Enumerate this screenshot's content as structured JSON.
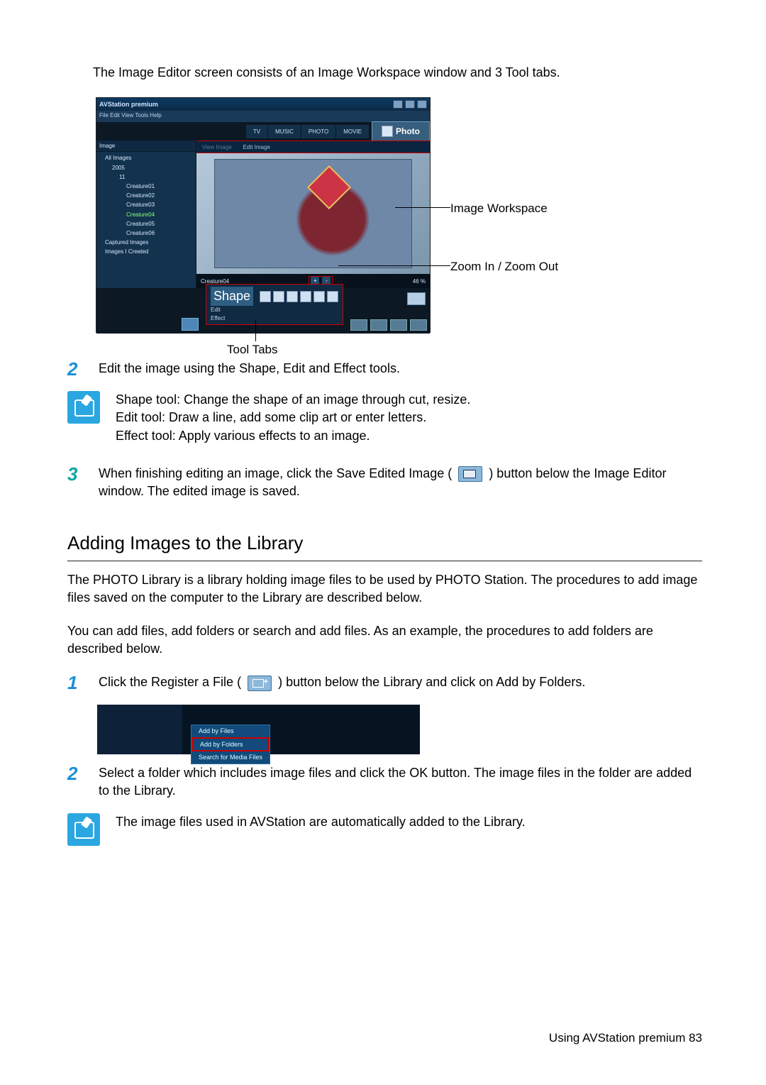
{
  "intro": "The Image Editor screen consists of an Image Workspace window and 3 Tool tabs.",
  "app": {
    "title": "AVStation premium",
    "menus": "File  Edit  View  Tools  Help",
    "navtabs": [
      "TV",
      "MUSIC",
      "PHOTO",
      "MOVIE"
    ],
    "badge": "Photo",
    "sidebar_header": "Image",
    "tree": {
      "root": "All Images",
      "year": "2005",
      "month": "11",
      "items": [
        "Creature01",
        "Creature02",
        "Creature03",
        "Creature04",
        "Creature05",
        "Creature06"
      ],
      "captured": "Captured Images",
      "created": "Images I Created"
    },
    "subtabs": {
      "view": "View Image",
      "edit": "Edit Image"
    },
    "ws_footer_left": "Creature04",
    "ws_footer_right": "46 %",
    "tool_labels": {
      "shape": "Shape",
      "edit": "Edit",
      "effect": "Effect"
    }
  },
  "callouts": {
    "workspace": "Image Workspace",
    "zoom": "Zoom In / Zoom Out",
    "tooltabs": "Tool Tabs"
  },
  "step2": "Edit the image using the Shape, Edit and Effect tools.",
  "note1": {
    "line1": "Shape tool: Change the shape of an image through cut, resize.",
    "line2": "Edit tool: Draw a line, add some clip art or enter letters.",
    "line3": "Effect tool: Apply various effects to an image."
  },
  "step3a": "When finishing editing an image, click the Save Edited Image (",
  "step3b": ") button below the Image Editor window. The edited image is saved.",
  "section_title": "Adding Images to the Library",
  "libpara1": "The PHOTO Library is a library holding image files to be used by PHOTO Station. The procedures to add image files saved on the computer to the Library are described below.",
  "libpara2": "You can add files, add folders or search and add files. As an example, the procedures to add folders are described below.",
  "lib_step1a": "Click the Register a File (",
  "lib_step1b": ") button below the Library and click on Add by Folders.",
  "menu_items": {
    "add_files": "Add by Files",
    "add_folders": "Add by Folders",
    "search": "Search for Media Files"
  },
  "lib_step2": "Select a folder which includes image files and click the OK button. The image files in the folder are added to the Library.",
  "note2": "The image files used in AVStation are automatically added to the Library.",
  "footer": "Using AVStation premium  83"
}
